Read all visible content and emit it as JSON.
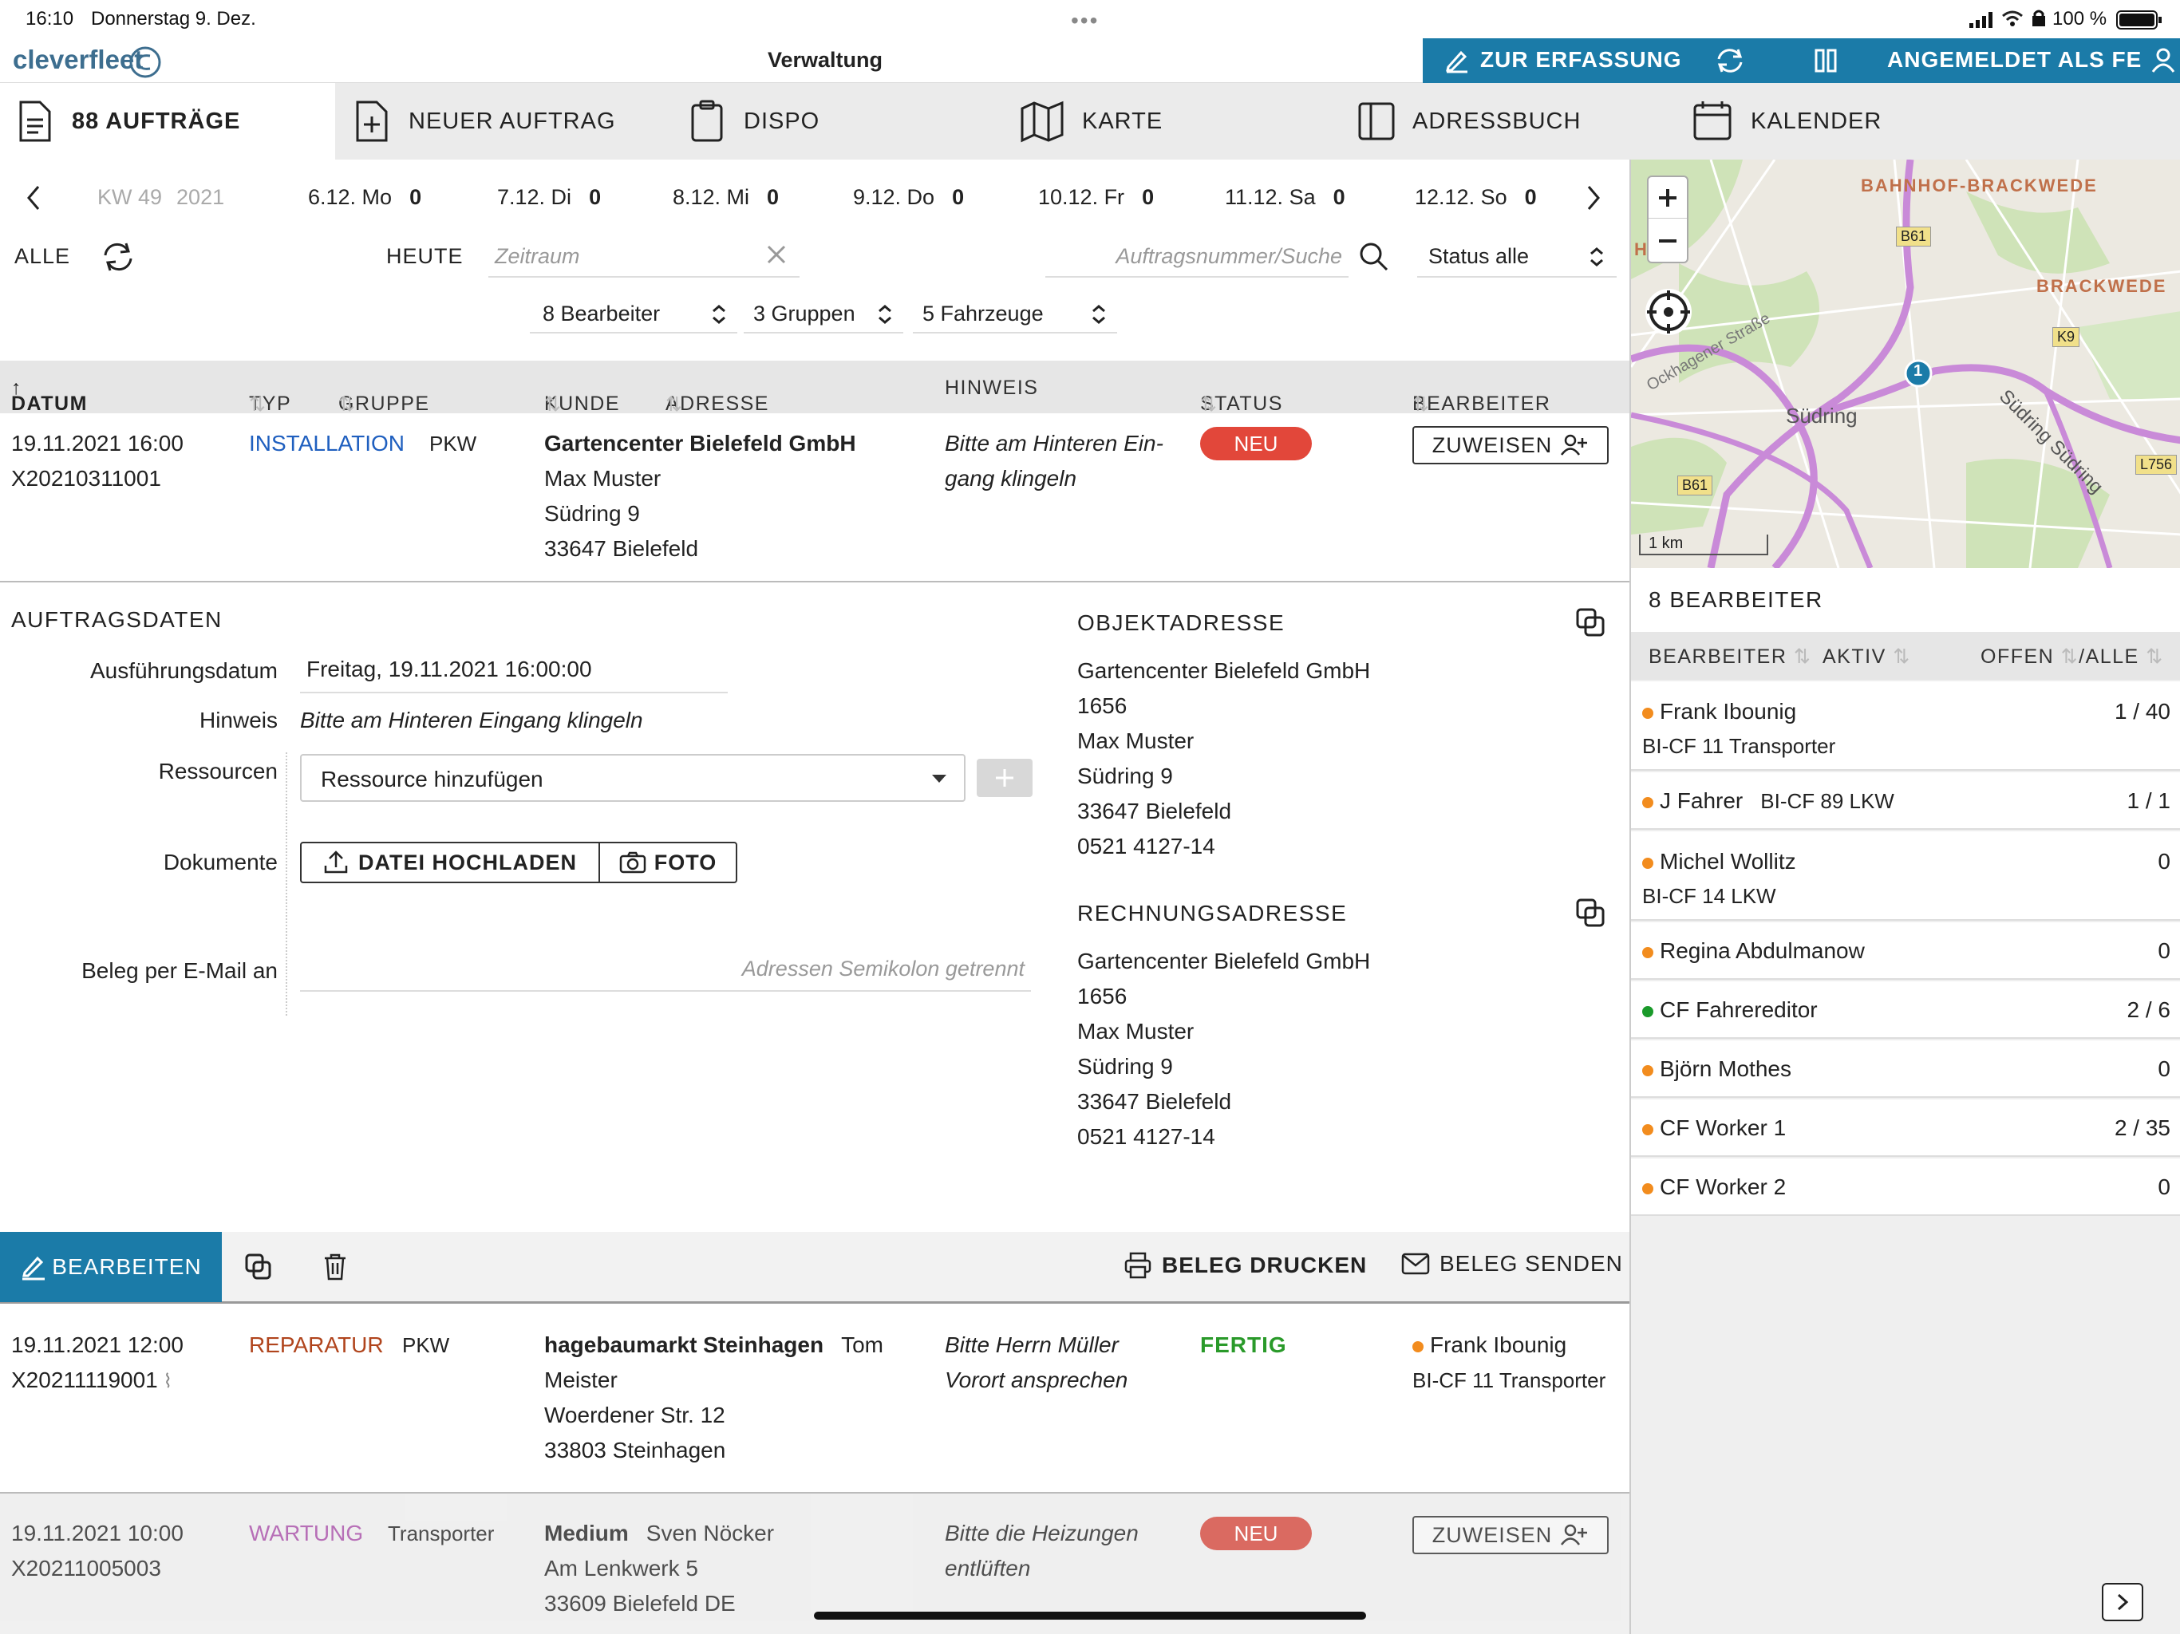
{
  "status_bar": {
    "time": "16:10",
    "date": "Donnerstag 9. Dez.",
    "battery": "100 %"
  },
  "header": {
    "logo_text": "cleverfleet",
    "title": "Verwaltung",
    "capture_label": "ZUR ERFASSUNG",
    "user_label": "ANGEMELDET ALS FE"
  },
  "tabs": [
    {
      "label": "88 AUFTRÄGE"
    },
    {
      "label": "NEUER AUFTRAG"
    },
    {
      "label": "DISPO"
    },
    {
      "label": "KARTE"
    },
    {
      "label": "ADRESSBUCH"
    },
    {
      "label": "KALENDER"
    }
  ],
  "week": {
    "kw": "KW 49",
    "year": "2021",
    "days": [
      {
        "label": "6.12. Mo",
        "count": "0"
      },
      {
        "label": "7.12. Di",
        "count": "0"
      },
      {
        "label": "8.12. Mi",
        "count": "0"
      },
      {
        "label": "9.12. Do",
        "count": "0"
      },
      {
        "label": "10.12. Fr",
        "count": "0"
      },
      {
        "label": "11.12. Sa",
        "count": "0"
      },
      {
        "label": "12.12. So",
        "count": "0"
      }
    ]
  },
  "filters": {
    "all": "ALLE",
    "today": "HEUTE",
    "period_placeholder": "Zeitraum",
    "search_placeholder": "Auftragsnummer/Suche",
    "status": "Status alle",
    "workers": "8 Bearbeiter",
    "groups": "3 Gruppen",
    "vehicles": "5 Fahrzeuge"
  },
  "columns": {
    "date": "DATUM",
    "type": "TYP",
    "group": "GRUPPE",
    "customer": "KUNDE",
    "address": "ADRESSE",
    "hint": "HINWEIS",
    "status": "STATUS",
    "worker": "BEARBEITER"
  },
  "orders": [
    {
      "datetime": "19.11.2021 16:00",
      "number": "X20210311001",
      "type": "INSTALLATION",
      "group": "PKW",
      "customer": "Gartencenter Bielefeld GmbH",
      "contact": "Max Muster",
      "street": "Südring 9",
      "city": "33647 Bielefeld",
      "hint": "Bitte am Hinteren Ein-",
      "hint2": "gang klingeln",
      "status": "NEU",
      "action": "ZUWEISEN"
    },
    {
      "datetime": "19.11.2021 12:00",
      "number": "X20211119001",
      "type": "REPARATUR",
      "group": "PKW",
      "customer": "hagebaumarkt Steinhagen",
      "contact_a": "Tom",
      "contact_b": "Meister",
      "street": "Woerdener Str. 12",
      "city": "33803 Steinhagen",
      "hint": "Bitte Herrn Müller",
      "hint2": "Vorort ansprechen",
      "status": "FERTIG",
      "worker": "Frank Ibounig",
      "worker_sub": "BI-CF 11  Transporter"
    },
    {
      "datetime": "19.11.2021 10:00",
      "number": "X20211005003",
      "type": "WARTUNG",
      "group": "Transporter",
      "customer": "Medium",
      "contact": "Sven Nöcker",
      "street": "Am Lenkwerk 5",
      "city": "33609 Bielefeld DE",
      "hint": "Bitte die Heizungen",
      "hint2": "entlüften",
      "status": "NEU",
      "action": "ZUWEISEN"
    }
  ],
  "details": {
    "title": "AUFTRAGSDATEN",
    "exec_label": "Ausführungsdatum",
    "exec_value": "Freitag, 19.11.2021 16:00:00",
    "hint_label": "Hinweis",
    "hint_value": "Bitte am Hinteren Eingang klingeln",
    "res_label": "Ressourcen",
    "res_value": "Ressource hinzufügen",
    "docs_label": "Dokumente",
    "upload": "DATEI HOCHLADEN",
    "photo": "FOTO",
    "mail_label": "Beleg per E-Mail an",
    "mail_placeholder": "Adressen Semikolon getrennt",
    "obj_title": "OBJEKTADRESSE",
    "obj": [
      "Gartencenter Bielefeld GmbH",
      "1656",
      "Max Muster",
      "Südring 9",
      "33647 Bielefeld",
      "0521 4127-14"
    ],
    "bill_title": "RECHNUNGSADRESSE",
    "bill": [
      "Gartencenter Bielefeld GmbH",
      "1656",
      "Max Muster",
      "Südring 9",
      "33647 Bielefeld",
      "0521 4127-14"
    ]
  },
  "actions": {
    "edit": "BEARBEITEN",
    "print": "BELEG DRUCKEN",
    "send": "BELEG SENDEN"
  },
  "map": {
    "labels": [
      "BAHNHOF-BRACKWEDE",
      "BRACKWEDE",
      "Südring",
      "Südring Südring",
      "Ockhagener Straße",
      "B61",
      "B61",
      "K9",
      "L756",
      "HI",
      "1 km",
      "1"
    ]
  },
  "workers_panel": {
    "title": "8 BEARBEITER",
    "col_worker": "BEARBEITER",
    "col_active": "AKTIV",
    "col_open": "OFFEN",
    "col_all": "/ALLE",
    "items": [
      {
        "name": "Frank Ibounig",
        "sub": "BI-CF 11  Transporter",
        "count": "1 / 40",
        "color": "#f28c1e"
      },
      {
        "name": "J Fahrer",
        "sub": "BI-CF 89  LKW",
        "count": "1 / 1",
        "color": "#f28c1e"
      },
      {
        "name": "Michel Wollitz",
        "sub": "BI-CF 14  LKW",
        "count": "0",
        "color": "#f28c1e"
      },
      {
        "name": "Regina Abdulmanow",
        "sub": "",
        "count": "0",
        "color": "#f28c1e"
      },
      {
        "name": "CF Fahrereditor",
        "sub": "",
        "count": "2 / 6",
        "color": "#1a9a2a"
      },
      {
        "name": "Björn Mothes",
        "sub": "",
        "count": "0",
        "color": "#f28c1e"
      },
      {
        "name": "CF Worker 1",
        "sub": "",
        "count": "2 / 35",
        "color": "#f28c1e"
      },
      {
        "name": "CF Worker 2",
        "sub": "",
        "count": "0",
        "color": "#f28c1e"
      }
    ]
  },
  "colors": {
    "brand_blue": "#1b7ba8",
    "status_new": "#e2473a",
    "status_done": "#2a9a2a",
    "type_install": "#1f5fbf",
    "type_repair": "#b0441c",
    "type_maint": "#a64ca6"
  }
}
